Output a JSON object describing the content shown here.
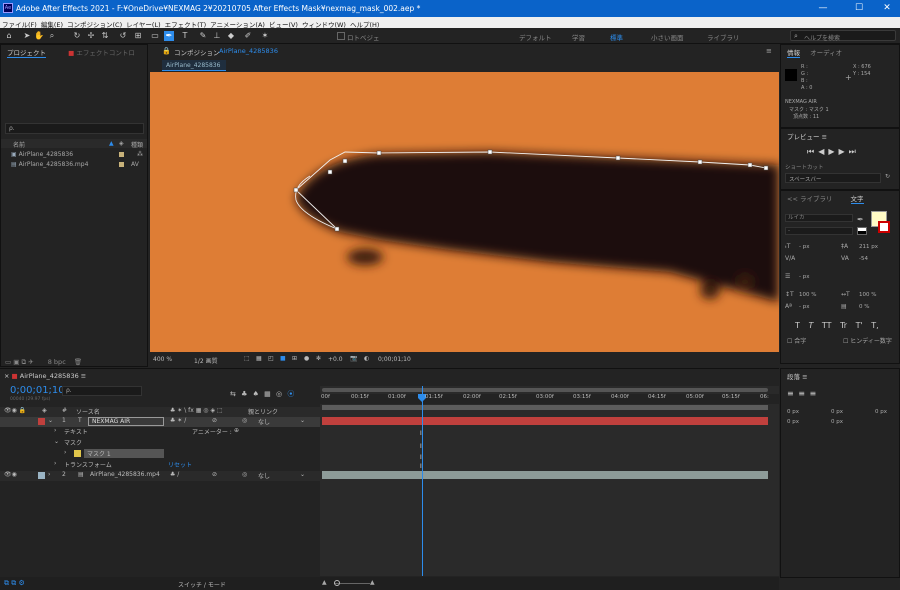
{
  "app": {
    "title": "Adobe After Effects 2021 - F:¥OneDrive¥NEXMAG 2¥20210705 After Effects Mask¥nexmag_mask_002.aep *",
    "logo": "Ae"
  },
  "window_controls": {
    "minimize": "—",
    "maximize": "☐",
    "close": "✕"
  },
  "menu": [
    "ファイル(F)",
    "編集(E)",
    "コンポジション(C)",
    "レイヤー(L)",
    "エフェクト(T)",
    "アニメーション(A)",
    "ビュー(V)",
    "ウィンドウ(W)",
    "ヘルプ(H)"
  ],
  "toolbar": {
    "roto": "ロトベジェ",
    "workspaces": [
      "デフォルト",
      "学習",
      "標準",
      "小さい画面",
      "ライブラリ"
    ],
    "active_workspace": "標準",
    "help_search": "ヘルプを検索"
  },
  "project": {
    "tab": "プロジェクト",
    "tab2": "エフェクトコントロ",
    "search_placeholder": "ρ.",
    "col_name": "名前",
    "col_type": "種類",
    "items": [
      {
        "name": "AirPlane_4285836",
        "type": "",
        "color": "#c8b27a"
      },
      {
        "name": "AirPlane_4285836.mp4",
        "type": "AV",
        "color": "#c8b27a"
      }
    ],
    "bpc": "8 bpc"
  },
  "composition": {
    "panel_label": "コンポジション",
    "comp_name": "AirPlane_4285836",
    "tab": "AirPlane_4285836",
    "zoom": "400 %",
    "resolution": "1/2 画質",
    "exposure": "+0.0",
    "timecode": "0;00;01;10"
  },
  "info": {
    "tab": "情報",
    "tab2": "オーディオ",
    "r": "R :",
    "g": "G :",
    "b": "B :",
    "a": "A : 0",
    "x": "X : 676",
    "y": "Y : 154",
    "layer": "NEXMAG AIR",
    "mask": "マスク : マスク 1",
    "vertex": "頂点数 : 11"
  },
  "preview": {
    "tab": "プレビュー",
    "shortcut_label": "ショートカット",
    "shortcut_value": "スペースバー"
  },
  "character": {
    "tab_library": "ライブラリ",
    "tab_char": "文字",
    "font": "ルイカ",
    "style": "-",
    "font_size": "211 px",
    "tracking": "-54",
    "leading": "- px",
    "v_scale": "100 %",
    "h_scale": "100 %",
    "baseline": "- px",
    "tsume": "0 %",
    "faux_styles": [
      "T",
      "T",
      "TT",
      "Tr",
      "T'",
      "T,"
    ],
    "all_caps": "合字",
    "hindi": "ヒンディー数字",
    "unit_px": "- px"
  },
  "paragraph": {
    "tab": "段落",
    "zero_px": "0 px"
  },
  "timeline": {
    "tab": "AirPlane_4285836",
    "timecode": "0;00;01;10",
    "fps": "00040 (29.97 fps)",
    "col_num": "#",
    "col_source": "ソース名",
    "col_parent": "親とリンク",
    "none": "なし",
    "animator": "アニメーター :",
    "reset": "リセット",
    "layers": [
      {
        "num": "1",
        "name": "NEXMAG AIR",
        "type": "T"
      },
      {
        "num": "2",
        "name": "AirPlane_4285836.mp4",
        "type": ""
      }
    ],
    "text_prop": "テキスト",
    "masks": "マスク",
    "mask1": "マスク 1",
    "transform": "トランスフォーム",
    "switches": "スイッチ / モード",
    "ruler": [
      "00f",
      "00:15f",
      "01:00f",
      "01:15f",
      "02:00f",
      "02:15f",
      "03:00f",
      "03:15f",
      "04:00f",
      "04:15f",
      "05:00f",
      "05:15f",
      "06:"
    ]
  },
  "colors": {
    "accent": "#2d8ceb",
    "layer_red": "#c0403d",
    "mask_yellow": "#e0c54a",
    "footage": "#8d9b98",
    "viewer_bg": "#de7d35"
  }
}
